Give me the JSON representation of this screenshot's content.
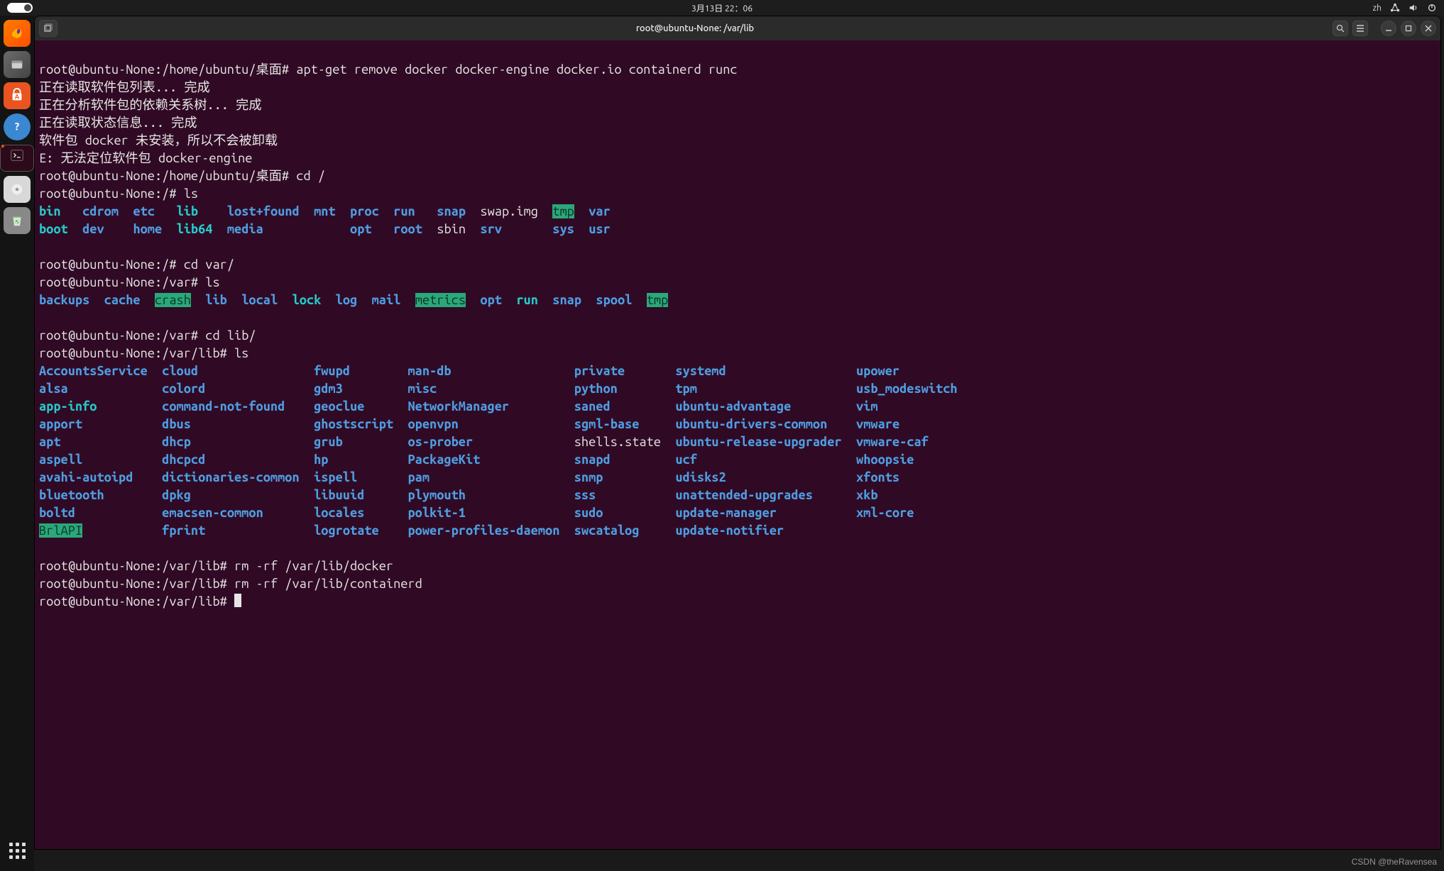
{
  "panel": {
    "clock": "3月13日 22：06",
    "ime": "zh"
  },
  "dock": {
    "apps": [
      "firefox",
      "files",
      "software",
      "help",
      "terminal",
      "media",
      "trash"
    ]
  },
  "window": {
    "title": "root@ubuntu-None: /var/lib"
  },
  "term": {
    "p1_prompt": "root@ubuntu-None:/home/ubuntu/桌面# ",
    "p1_cmd": "apt-get remove docker docker-engine docker.io containerd runc",
    "l_reading_pkg": "正在读取软件包列表... 完成",
    "l_deptree": "正在分析软件包的依赖关系树... 完成",
    "l_state": "正在读取状态信息... 完成",
    "l_not_installed": "软件包 docker 未安装，所以不会被卸载",
    "l_err": "E: 无法定位软件包 docker-engine",
    "p2_prompt": "root@ubuntu-None:/home/ubuntu/桌面# ",
    "p2_cmd": "cd /",
    "p3_prompt": "root@ubuntu-None:/# ",
    "p3_cmd": "ls",
    "ls_root": {
      "r1": [
        "bin",
        "cdrom",
        "etc",
        "lib",
        "lost+found",
        "mnt",
        "proc",
        "run",
        "snap",
        "swap.img",
        "tmp",
        "var"
      ],
      "r2": [
        "boot",
        "dev",
        "home",
        "lib64",
        "media",
        "",
        "opt",
        "root",
        "sbin",
        "srv",
        "sys",
        "usr"
      ],
      "link_cols_r1": [
        0,
        3
      ],
      "link_cols_r2": [
        0,
        3
      ],
      "file_cols_r1": [
        9
      ],
      "file_cols_r2": [
        8
      ],
      "sticky_cols_r1": [
        10
      ]
    },
    "p4_prompt": "root@ubuntu-None:/# ",
    "p4_cmd": "cd var/",
    "p5_prompt": "root@ubuntu-None:/var# ",
    "p5_cmd": "ls",
    "ls_var": {
      "row": [
        "backups",
        "cache",
        "crash",
        "lib",
        "local",
        "lock",
        "log",
        "mail",
        "metrics",
        "opt",
        "run",
        "snap",
        "spool",
        "tmp"
      ],
      "link_cols": [
        5,
        10
      ],
      "sticky_cols": [
        2,
        8,
        13
      ]
    },
    "p6_prompt": "root@ubuntu-None:/var# ",
    "p6_cmd": "cd lib/",
    "p7_prompt": "root@ubuntu-None:/var/lib# ",
    "p7_cmd": "ls",
    "ls_lib": {
      "rows": [
        [
          "AccountsService",
          "cloud",
          "fwupd",
          "man-db",
          "private",
          "systemd",
          "upower"
        ],
        [
          "alsa",
          "colord",
          "gdm3",
          "misc",
          "python",
          "tpm",
          "usb_modeswitch"
        ],
        [
          "app-info",
          "command-not-found",
          "geoclue",
          "NetworkManager",
          "saned",
          "ubuntu-advantage",
          "vim"
        ],
        [
          "apport",
          "dbus",
          "ghostscript",
          "openvpn",
          "sgml-base",
          "ubuntu-drivers-common",
          "vmware"
        ],
        [
          "apt",
          "dhcp",
          "grub",
          "os-prober",
          "shells.state",
          "ubuntu-release-upgrader",
          "vmware-caf"
        ],
        [
          "aspell",
          "dhcpcd",
          "hp",
          "PackageKit",
          "snapd",
          "ucf",
          "whoopsie"
        ],
        [
          "avahi-autoipd",
          "dictionaries-common",
          "ispell",
          "pam",
          "snmp",
          "udisks2",
          "xfonts"
        ],
        [
          "bluetooth",
          "dpkg",
          "libuuid",
          "plymouth",
          "sss",
          "unattended-upgrades",
          "xkb"
        ],
        [
          "boltd",
          "emacsen-common",
          "locales",
          "polkit-1",
          "sudo",
          "update-manager",
          "xml-core"
        ],
        [
          "BrlAPI",
          "fprint",
          "logrotate",
          "power-profiles-daemon",
          "swcatalog",
          "update-notifier",
          ""
        ]
      ],
      "file_cells": [
        [
          4,
          4
        ]
      ],
      "link_cells": [
        [
          2,
          0
        ]
      ],
      "sticky_cells": [
        [
          9,
          0
        ]
      ]
    },
    "p8_prompt": "root@ubuntu-None:/var/lib# ",
    "p8_cmd": "rm -rf /var/lib/docker",
    "p9_prompt": "root@ubuntu-None:/var/lib# ",
    "p9_cmd": "rm -rf /var/lib/containerd",
    "p10_prompt": "root@ubuntu-None:/var/lib# "
  },
  "watermark": "CSDN @theRavensea"
}
